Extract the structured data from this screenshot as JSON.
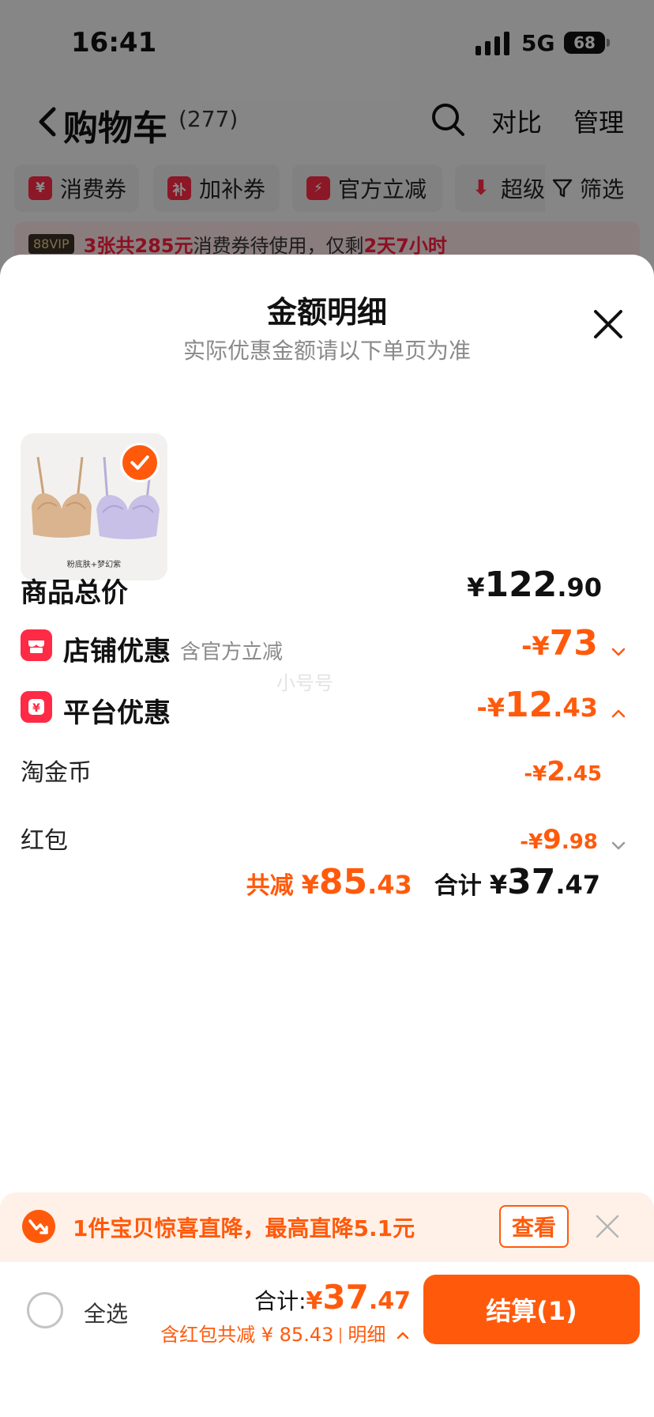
{
  "status_bar": {
    "time": "16:41",
    "network": "5G",
    "battery": "68"
  },
  "cart_header": {
    "title": "购物车",
    "count": "(277)",
    "compare": "对比",
    "manage": "管理"
  },
  "coupon_chips": [
    {
      "icon_text": "¥",
      "label": "消费券"
    },
    {
      "icon_text": "补",
      "label": "加补券"
    },
    {
      "icon_text": "",
      "label": "官方立减"
    },
    {
      "icon_text": "",
      "label": "超级"
    }
  ],
  "filter_label": "筛选",
  "vip_banner": {
    "badge": "88VIP",
    "highlight1": "3张共285元",
    "text1": "消费券待使用，仅剩",
    "highlight2": "2天7小时"
  },
  "sheet": {
    "title": "金额明细",
    "subtitle": "实际优惠金额请以下单页为准",
    "product_caption": "粉底肤+梦幻紫",
    "watermark": "小号号"
  },
  "breakdown": {
    "total_price": {
      "label": "商品总价",
      "currency": "¥",
      "int": "122",
      "dec": ".90"
    },
    "store_discount": {
      "label": "店铺优惠",
      "sub": "含官方立减",
      "prefix": "-¥",
      "int": "73",
      "dec": ""
    },
    "platform_discount": {
      "label": "平台优惠",
      "prefix": "-¥",
      "int": "12",
      "dec": ".43"
    },
    "tao_coin": {
      "label": "淘金币",
      "prefix": "-¥",
      "int": "2",
      "dec": ".45"
    },
    "red_packet": {
      "label": "红包",
      "prefix": "-¥",
      "int": "9",
      "dec": ".98"
    }
  },
  "summary": {
    "reduce_label": "共减",
    "reduce_currency": "¥",
    "reduce_int": "85",
    "reduce_dec": ".43",
    "total_label": "合计",
    "total_currency": "¥",
    "total_int": "37",
    "total_dec": ".47"
  },
  "promo": {
    "text": "1件宝贝惊喜直降，最高直降5.1元",
    "button": "查看"
  },
  "bottom_bar": {
    "select_all": "全选",
    "total_label": "合计:",
    "currency": "¥",
    "total_int": "37",
    "total_dec": ".47",
    "sub_text": "含红包共减 ¥ 85.43",
    "detail_link": "明细",
    "checkout": "结算(1)"
  },
  "colors": {
    "accent": "#ff5a0c",
    "brand_red": "#ff2a45",
    "overlay": "rgba(0,0,0,0.45)"
  }
}
